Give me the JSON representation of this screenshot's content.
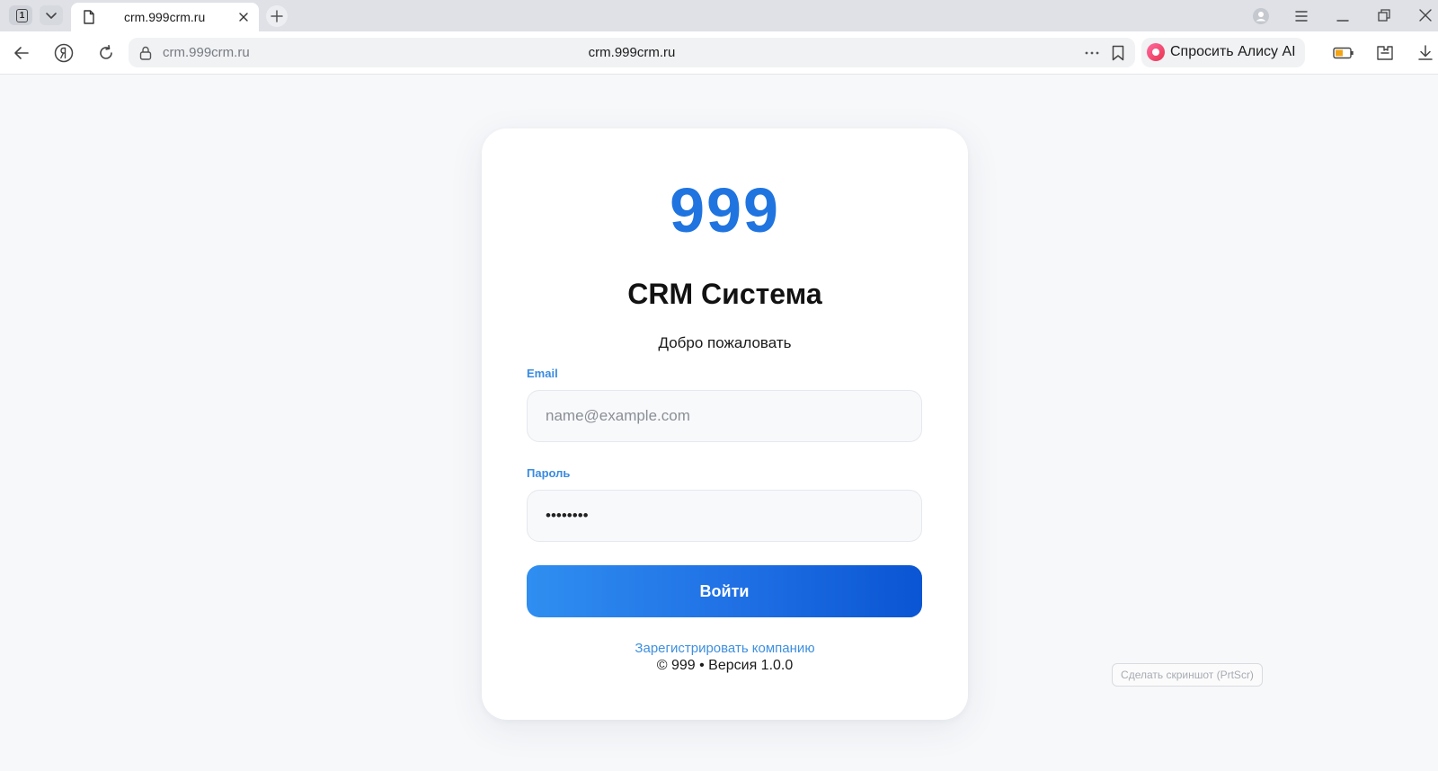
{
  "browser": {
    "tab_counter": "1",
    "active_tab_title": "crm.999crm.ru",
    "address_url": "crm.999crm.ru",
    "address_url_center": "crm.999crm.ru",
    "alice_label": "Спросить Алису AI",
    "screenshot_hint": "Сделать скриншот (PrtScr)"
  },
  "login": {
    "logo": "999",
    "title": "CRM Система",
    "subtitle": "Добро пожаловать",
    "email_label": "Email",
    "email_placeholder": "name@example.com",
    "email_value": "",
    "password_label": "Пароль",
    "password_value": "12345678",
    "submit_label": "Войти",
    "register_link": "Зарегистрировать компанию",
    "copyright": "© 999 • Версия 1.0.0"
  },
  "colors": {
    "brand": "#1f74e0",
    "label": "#3a8be0",
    "button_start": "#2f8ef0",
    "button_end": "#0a55d3",
    "page_bg": "#f7f8fa"
  }
}
